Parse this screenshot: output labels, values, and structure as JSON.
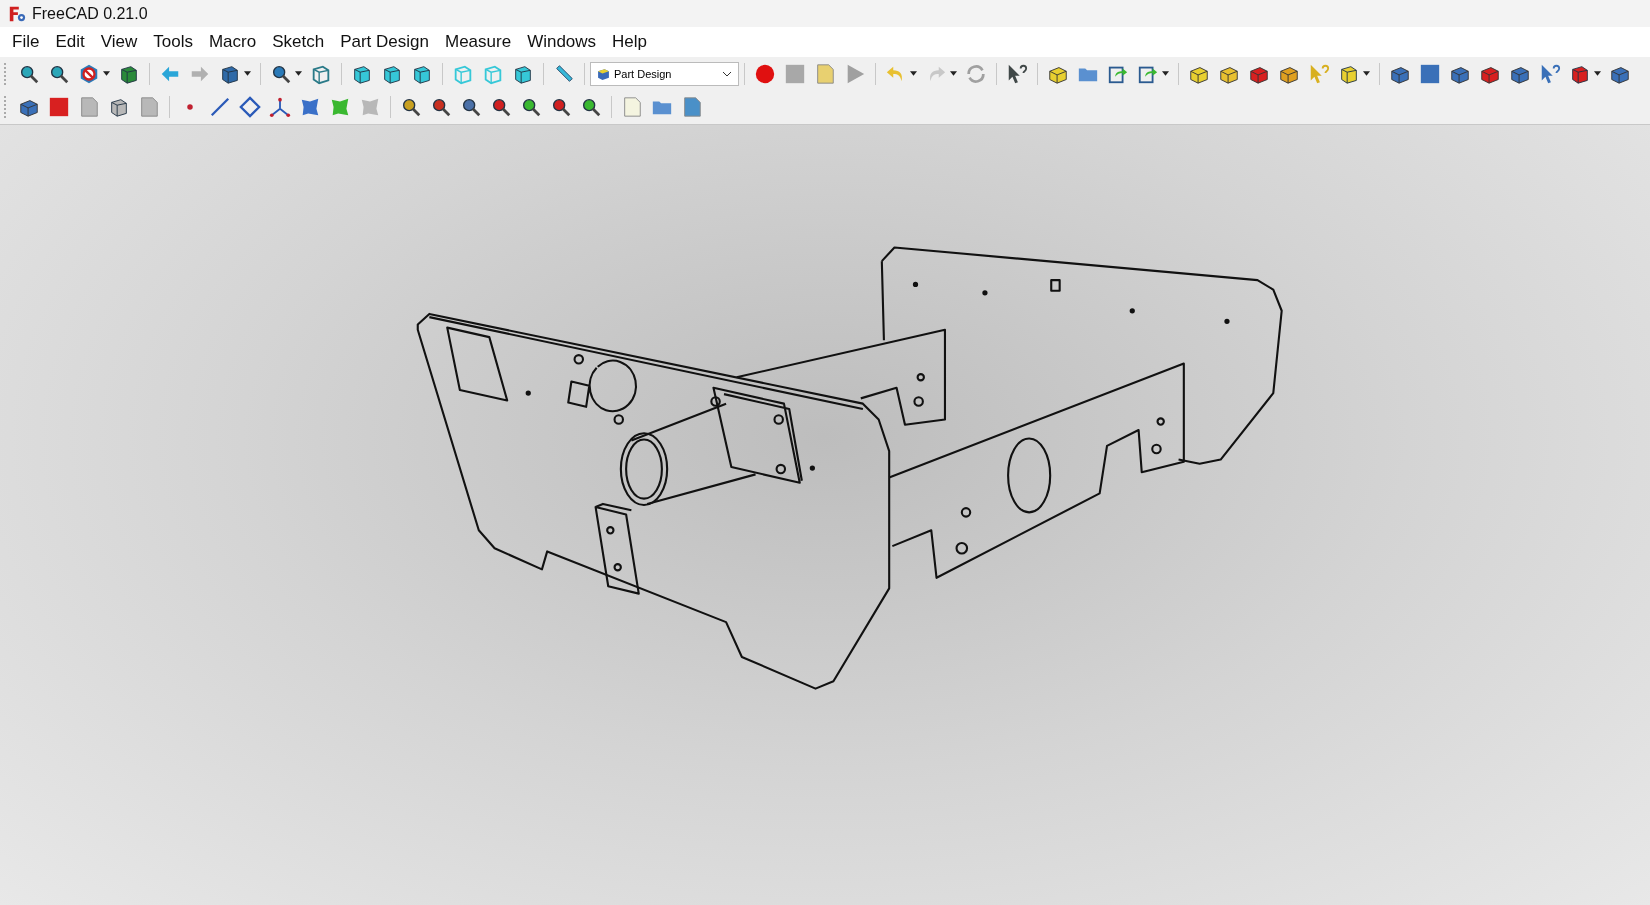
{
  "window": {
    "title": "FreeCAD 0.21.0"
  },
  "menu": [
    "File",
    "Edit",
    "View",
    "Tools",
    "Macro",
    "Sketch",
    "Part Design",
    "Measure",
    "Windows",
    "Help"
  ],
  "workbench_selector": {
    "value": "Part Design"
  }
}
